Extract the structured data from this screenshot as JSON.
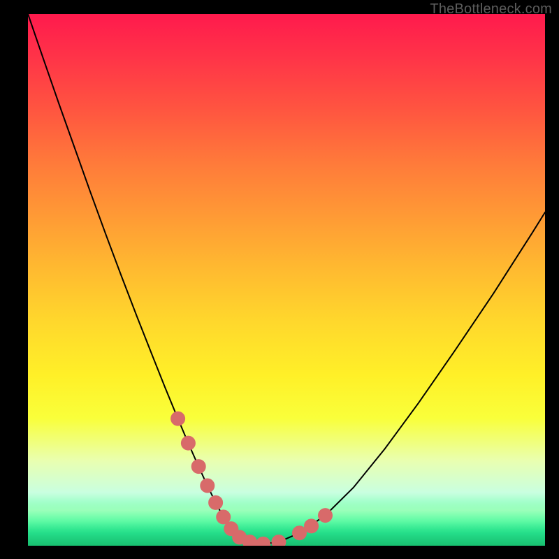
{
  "watermark": {
    "text": "TheBottleneck.com"
  },
  "colors": {
    "curve_stroke": "#000000",
    "marker_fill": "#d86a6a",
    "marker_stroke": "#d86a6a",
    "frame": "#000000"
  },
  "chart_data": {
    "type": "line",
    "title": "",
    "xlabel": "",
    "ylabel": "",
    "xlim": [
      0,
      100
    ],
    "ylim": [
      0,
      100
    ],
    "grid": false,
    "legend": false,
    "series": [
      {
        "name": "bottleneck-curve",
        "x": [
          0,
          3,
          6,
          9,
          12,
          15,
          18,
          21,
          24,
          26.5,
          29,
          31,
          33,
          34.7,
          36.3,
          37.8,
          39.3,
          40.9,
          42.9,
          45.5,
          48.5,
          52.5,
          57.5,
          63,
          69,
          75.5,
          82.5,
          90,
          97.5,
          100
        ],
        "y": [
          100,
          91.5,
          83.1,
          74.9,
          66.7,
          58.7,
          50.9,
          43.3,
          35.9,
          29.8,
          23.9,
          19.3,
          14.9,
          11.3,
          8.1,
          5.4,
          3.2,
          1.6,
          0.7,
          0.35,
          0.7,
          2.4,
          5.7,
          11,
          18.2,
          26.8,
          36.6,
          47.4,
          58.8,
          62.7
        ],
        "stroke_width": 2
      }
    ],
    "markers": {
      "name": "highlight-dots",
      "points": [
        {
          "x": 29.0,
          "y": 23.9
        },
        {
          "x": 31.0,
          "y": 19.3
        },
        {
          "x": 33.0,
          "y": 14.9
        },
        {
          "x": 34.7,
          "y": 11.3
        },
        {
          "x": 36.3,
          "y": 8.1
        },
        {
          "x": 37.8,
          "y": 5.4
        },
        {
          "x": 39.3,
          "y": 3.2
        },
        {
          "x": 40.9,
          "y": 1.6
        },
        {
          "x": 42.9,
          "y": 0.7
        },
        {
          "x": 45.5,
          "y": 0.35
        },
        {
          "x": 48.5,
          "y": 0.7
        },
        {
          "x": 52.5,
          "y": 2.4
        },
        {
          "x": 54.8,
          "y": 3.7
        },
        {
          "x": 57.5,
          "y": 5.7
        }
      ],
      "radius": 10
    }
  }
}
